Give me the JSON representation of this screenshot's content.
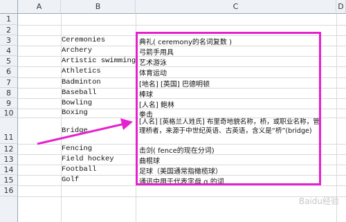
{
  "columns": [
    "A",
    "B",
    "C",
    "D"
  ],
  "rows": [
    "1",
    "2",
    "3",
    "4",
    "5",
    "6",
    "7",
    "8",
    "9",
    "10",
    "11",
    "12",
    "13",
    "14",
    "15",
    "16"
  ],
  "cells": [
    {
      "row": "3",
      "en": "Ceremonies",
      "cn": "典礼( ceremony的名词复数 )"
    },
    {
      "row": "4",
      "en": "Archery",
      "cn": "弓箭手用具"
    },
    {
      "row": "5",
      "en": "Artistic swimming",
      "cn": "艺术游泳"
    },
    {
      "row": "6",
      "en": "Athletics",
      "cn": "体育运动"
    },
    {
      "row": "7",
      "en": "Badminton",
      "cn": "[地名] [英国] 巴德明顿"
    },
    {
      "row": "8",
      "en": "Baseball",
      "cn": "棒球"
    },
    {
      "row": "9",
      "en": "Bowling",
      "cn": "[人名] 鲍林"
    },
    {
      "row": "10",
      "en": "Boxing",
      "cn": "拳击"
    },
    {
      "row": "11",
      "en": "Bridge",
      "cn": "[人名] [英格兰人姓氏] 布里奇地貌名称，桥，或职业名称，管理桥者，来源于中世纪英语、古英语，含义是“桥”(bridge)"
    },
    {
      "row": "12",
      "en": "Fencing",
      "cn": "击剑( fence的现在分词)"
    },
    {
      "row": "13",
      "en": "Field hockey",
      "cn": "曲棍球"
    },
    {
      "row": "14",
      "en": "Football",
      "cn": "足球（美国通常指橄榄球）"
    },
    {
      "row": "15",
      "en": "Golf",
      "cn": "通讯中用于代表字母 g 的词"
    }
  ],
  "watermark": "Baidu经验",
  "colors": {
    "highlight": "#e620cf",
    "arrow": "#e620cf",
    "header_bg": "#eef2f7"
  }
}
